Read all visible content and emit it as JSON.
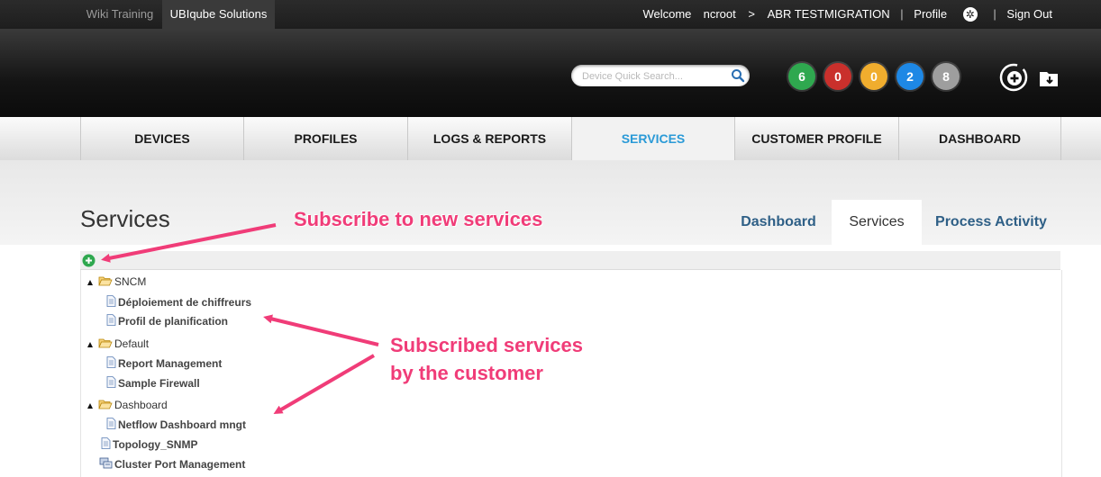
{
  "topbar": {
    "tabs": [
      "Wiki Training",
      "UBIqube Solutions"
    ],
    "welcome_label": "Welcome",
    "username": "ncroot",
    "arrow": ">",
    "customer": "ABR TESTMIGRATION",
    "profile_link": "Profile",
    "signout_link": "Sign Out"
  },
  "header": {
    "search": {
      "placeholder": "Device Quick Search..."
    },
    "badges": [
      {
        "value": "6",
        "color": "#2fa84f"
      },
      {
        "value": "0",
        "color": "#c9302c"
      },
      {
        "value": "0",
        "color": "#f0ad2e"
      },
      {
        "value": "2",
        "color": "#1e88e5"
      },
      {
        "value": "8",
        "color": "#9e9e9e"
      }
    ]
  },
  "nav": {
    "items": [
      "DEVICES",
      "PROFILES",
      "LOGS & REPORTS",
      "SERVICES",
      "CUSTOMER PROFILE",
      "DASHBOARD"
    ],
    "active": "SERVICES"
  },
  "page": {
    "title": "Services",
    "subtabs": [
      "Dashboard",
      "Services",
      "Process Activity"
    ],
    "active_subtab": "Services"
  },
  "tree": {
    "folders": [
      {
        "name": "SNCM",
        "items": [
          "Déploiement de chiffreurs",
          "Profil de planification"
        ]
      },
      {
        "name": "Default",
        "items": [
          "Report Management",
          "Sample Firewall"
        ]
      },
      {
        "name": "Dashboard",
        "items": [
          "Netflow Dashboard mngt"
        ]
      }
    ],
    "root_items": [
      "Topology_SNMP",
      "Cluster Port Management"
    ]
  },
  "annotations": {
    "subscribe": "Subscribe to new services",
    "subscribed_line1": "Subscribed services",
    "subscribed_line2": "by the customer"
  },
  "colors": {
    "accent": "#2a9ad7",
    "annotation": "#f03c78",
    "subtab_link": "#2e5f86"
  }
}
